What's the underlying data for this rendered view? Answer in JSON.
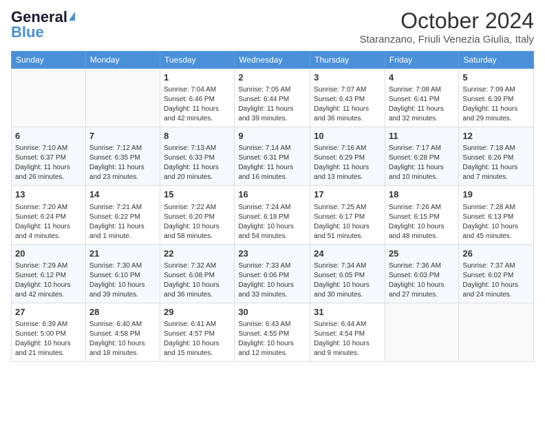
{
  "header": {
    "logo_line1": "General",
    "logo_line2": "Blue",
    "month": "October 2024",
    "location": "Staranzano, Friuli Venezia Giulia, Italy"
  },
  "weekdays": [
    "Sunday",
    "Monday",
    "Tuesday",
    "Wednesday",
    "Thursday",
    "Friday",
    "Saturday"
  ],
  "weeks": [
    [
      {
        "day": "",
        "info": ""
      },
      {
        "day": "",
        "info": ""
      },
      {
        "day": "1",
        "info": "Sunrise: 7:04 AM\nSunset: 6:46 PM\nDaylight: 11 hours and 42 minutes."
      },
      {
        "day": "2",
        "info": "Sunrise: 7:05 AM\nSunset: 6:44 PM\nDaylight: 11 hours and 39 minutes."
      },
      {
        "day": "3",
        "info": "Sunrise: 7:07 AM\nSunset: 6:43 PM\nDaylight: 11 hours and 36 minutes."
      },
      {
        "day": "4",
        "info": "Sunrise: 7:08 AM\nSunset: 6:41 PM\nDaylight: 11 hours and 32 minutes."
      },
      {
        "day": "5",
        "info": "Sunrise: 7:09 AM\nSunset: 6:39 PM\nDaylight: 11 hours and 29 minutes."
      }
    ],
    [
      {
        "day": "6",
        "info": "Sunrise: 7:10 AM\nSunset: 6:37 PM\nDaylight: 11 hours and 26 minutes."
      },
      {
        "day": "7",
        "info": "Sunrise: 7:12 AM\nSunset: 6:35 PM\nDaylight: 11 hours and 23 minutes."
      },
      {
        "day": "8",
        "info": "Sunrise: 7:13 AM\nSunset: 6:33 PM\nDaylight: 11 hours and 20 minutes."
      },
      {
        "day": "9",
        "info": "Sunrise: 7:14 AM\nSunset: 6:31 PM\nDaylight: 11 hours and 16 minutes."
      },
      {
        "day": "10",
        "info": "Sunrise: 7:16 AM\nSunset: 6:29 PM\nDaylight: 11 hours and 13 minutes."
      },
      {
        "day": "11",
        "info": "Sunrise: 7:17 AM\nSunset: 6:28 PM\nDaylight: 11 hours and 10 minutes."
      },
      {
        "day": "12",
        "info": "Sunrise: 7:18 AM\nSunset: 6:26 PM\nDaylight: 11 hours and 7 minutes."
      }
    ],
    [
      {
        "day": "13",
        "info": "Sunrise: 7:20 AM\nSunset: 6:24 PM\nDaylight: 11 hours and 4 minutes."
      },
      {
        "day": "14",
        "info": "Sunrise: 7:21 AM\nSunset: 6:22 PM\nDaylight: 11 hours and 1 minute."
      },
      {
        "day": "15",
        "info": "Sunrise: 7:22 AM\nSunset: 6:20 PM\nDaylight: 10 hours and 58 minutes."
      },
      {
        "day": "16",
        "info": "Sunrise: 7:24 AM\nSunset: 6:18 PM\nDaylight: 10 hours and 54 minutes."
      },
      {
        "day": "17",
        "info": "Sunrise: 7:25 AM\nSunset: 6:17 PM\nDaylight: 10 hours and 51 minutes."
      },
      {
        "day": "18",
        "info": "Sunrise: 7:26 AM\nSunset: 6:15 PM\nDaylight: 10 hours and 48 minutes."
      },
      {
        "day": "19",
        "info": "Sunrise: 7:28 AM\nSunset: 6:13 PM\nDaylight: 10 hours and 45 minutes."
      }
    ],
    [
      {
        "day": "20",
        "info": "Sunrise: 7:29 AM\nSunset: 6:12 PM\nDaylight: 10 hours and 42 minutes."
      },
      {
        "day": "21",
        "info": "Sunrise: 7:30 AM\nSunset: 6:10 PM\nDaylight: 10 hours and 39 minutes."
      },
      {
        "day": "22",
        "info": "Sunrise: 7:32 AM\nSunset: 6:08 PM\nDaylight: 10 hours and 36 minutes."
      },
      {
        "day": "23",
        "info": "Sunrise: 7:33 AM\nSunset: 6:06 PM\nDaylight: 10 hours and 33 minutes."
      },
      {
        "day": "24",
        "info": "Sunrise: 7:34 AM\nSunset: 6:05 PM\nDaylight: 10 hours and 30 minutes."
      },
      {
        "day": "25",
        "info": "Sunrise: 7:36 AM\nSunset: 6:03 PM\nDaylight: 10 hours and 27 minutes."
      },
      {
        "day": "26",
        "info": "Sunrise: 7:37 AM\nSunset: 6:02 PM\nDaylight: 10 hours and 24 minutes."
      }
    ],
    [
      {
        "day": "27",
        "info": "Sunrise: 6:39 AM\nSunset: 5:00 PM\nDaylight: 10 hours and 21 minutes."
      },
      {
        "day": "28",
        "info": "Sunrise: 6:40 AM\nSunset: 4:58 PM\nDaylight: 10 hours and 18 minutes."
      },
      {
        "day": "29",
        "info": "Sunrise: 6:41 AM\nSunset: 4:57 PM\nDaylight: 10 hours and 15 minutes."
      },
      {
        "day": "30",
        "info": "Sunrise: 6:43 AM\nSunset: 4:55 PM\nDaylight: 10 hours and 12 minutes."
      },
      {
        "day": "31",
        "info": "Sunrise: 6:44 AM\nSunset: 4:54 PM\nDaylight: 10 hours and 9 minutes."
      },
      {
        "day": "",
        "info": ""
      },
      {
        "day": "",
        "info": ""
      }
    ]
  ]
}
